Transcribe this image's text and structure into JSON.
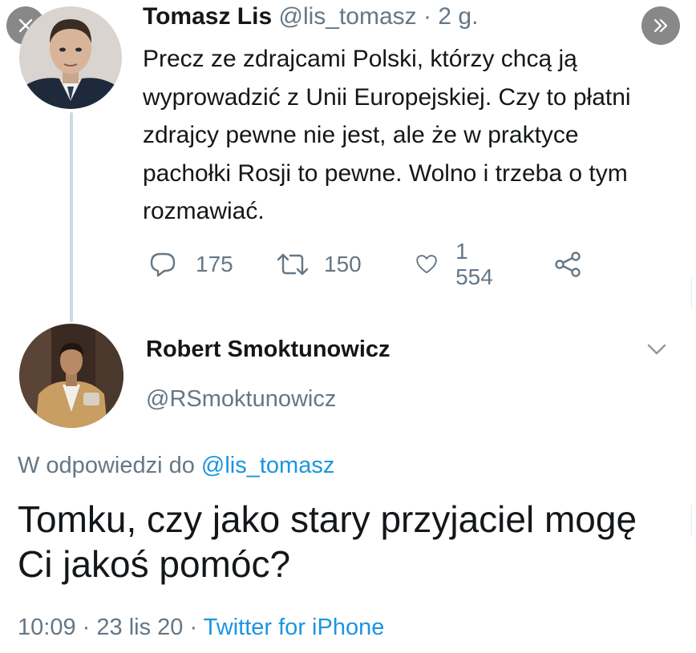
{
  "tweet": {
    "author_name": "Tomasz Lis",
    "author_handle": "@lis_tomasz",
    "separator": "·",
    "age": "2 g.",
    "text": "Precz ze zdrajcami Polski, którzy chcą ją wyprowadzić z Unii Europejskiej. Czy to płatni zdrajcy pewne nie  jest, ale że w praktyce pachołki Rosji to pewne. Wolno i trzeba o tym rozmawiać.",
    "reply_count": "175",
    "retweet_count": "150",
    "like_count": "1 554"
  },
  "reply": {
    "author_name": "Robert Smoktunowicz",
    "author_handle": "@RSmoktunowicz",
    "reply_prefix": "W odpowiedzi do",
    "reply_mention": "@lis_tomasz",
    "text": "Tomku, czy jako stary przyjaciel mogę Ci jakoś pomóc?",
    "time": "10:09",
    "date": "23 lis 20",
    "separator": "·",
    "source": "Twitter for iPhone"
  },
  "icons": {
    "close": "close-icon",
    "next": "double-chevron-right-icon",
    "reply": "reply-bubble-icon",
    "retweet": "retweet-icon",
    "like": "heart-icon",
    "share": "share-icon",
    "more": "chevron-down-icon"
  },
  "colors": {
    "text": "#14171a",
    "muted": "#657786",
    "link": "#1b95e0",
    "overlay_button": "#6e6e6e"
  }
}
